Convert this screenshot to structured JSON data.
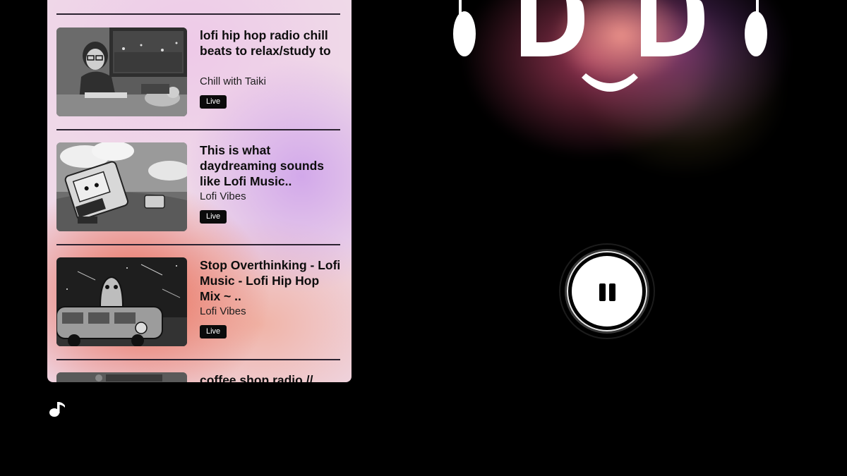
{
  "playlist": {
    "items": [
      {
        "title": "lofi hip hop radio chill beats to relax/study to",
        "channel": "Chill with Taiki",
        "badge": "Live"
      },
      {
        "title": "This is what daydreaming sounds like  Lofi Music..",
        "channel": "Lofi Vibes",
        "badge": "Live"
      },
      {
        "title": "Stop Overthinking - Lofi Music - Lofi Hip Hop Mix ~ ..",
        "channel": "Lofi Vibes",
        "badge": "Live"
      },
      {
        "title": "coffee shop radio //"
      }
    ]
  },
  "icons": {
    "note": "music-note-icon",
    "pause": "pause-icon",
    "logo": "headphones-face-logo"
  },
  "colors": {
    "background": "#000000",
    "badge": "#0b0b0b",
    "panel_pink": "#efd9e8",
    "panel_coral": "#e86046",
    "panel_lavender": "#cda0eb"
  }
}
